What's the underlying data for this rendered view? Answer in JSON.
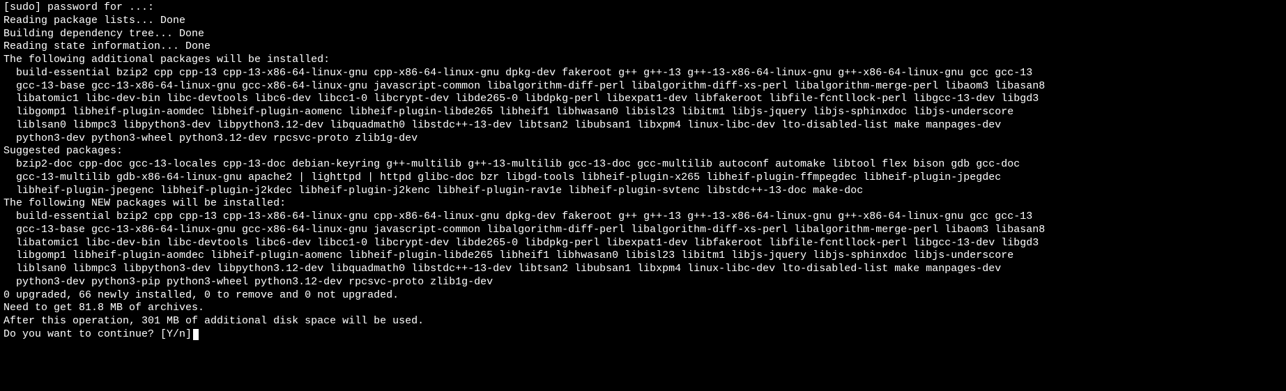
{
  "terminal": {
    "line0": "[sudo] password for ...:",
    "line1": "Reading package lists... Done",
    "line2": "Building dependency tree... Done",
    "line3": "Reading state information... Done",
    "line4": "The following additional packages will be installed:",
    "additional_pkg_1": "build-essential bzip2 cpp cpp-13 cpp-13-x86-64-linux-gnu cpp-x86-64-linux-gnu dpkg-dev fakeroot g++ g++-13 g++-13-x86-64-linux-gnu g++-x86-64-linux-gnu gcc gcc-13",
    "additional_pkg_2": "gcc-13-base gcc-13-x86-64-linux-gnu gcc-x86-64-linux-gnu javascript-common libalgorithm-diff-perl libalgorithm-diff-xs-perl libalgorithm-merge-perl libaom3 libasan8",
    "additional_pkg_3": "libatomic1 libc-dev-bin libc-devtools libc6-dev libcc1-0 libcrypt-dev libde265-0 libdpkg-perl libexpat1-dev libfakeroot libfile-fcntllock-perl libgcc-13-dev libgd3",
    "additional_pkg_4": "libgomp1 libheif-plugin-aomdec libheif-plugin-aomenc libheif-plugin-libde265 libheif1 libhwasan0 libisl23 libitm1 libjs-jquery libjs-sphinxdoc libjs-underscore",
    "additional_pkg_5": "liblsan0 libmpc3 libpython3-dev libpython3.12-dev libquadmath0 libstdc++-13-dev libtsan2 libubsan1 libxpm4 linux-libc-dev lto-disabled-list make manpages-dev",
    "additional_pkg_6": "python3-dev python3-wheel python3.12-dev rpcsvc-proto zlib1g-dev",
    "line_suggested": "Suggested packages:",
    "suggested_pkg_1": "bzip2-doc cpp-doc gcc-13-locales cpp-13-doc debian-keyring g++-multilib g++-13-multilib gcc-13-doc gcc-multilib autoconf automake libtool flex bison gdb gcc-doc",
    "suggested_pkg_2": "gcc-13-multilib gdb-x86-64-linux-gnu apache2 | lighttpd | httpd glibc-doc bzr libgd-tools libheif-plugin-x265 libheif-plugin-ffmpegdec libheif-plugin-jpegdec",
    "suggested_pkg_3": "libheif-plugin-jpegenc libheif-plugin-j2kdec libheif-plugin-j2kenc libheif-plugin-rav1e libheif-plugin-svtenc libstdc++-13-doc make-doc",
    "line_new": "The following NEW packages will be installed:",
    "new_pkg_1": "build-essential bzip2 cpp cpp-13 cpp-13-x86-64-linux-gnu cpp-x86-64-linux-gnu dpkg-dev fakeroot g++ g++-13 g++-13-x86-64-linux-gnu g++-x86-64-linux-gnu gcc gcc-13",
    "new_pkg_2": "gcc-13-base gcc-13-x86-64-linux-gnu gcc-x86-64-linux-gnu javascript-common libalgorithm-diff-perl libalgorithm-diff-xs-perl libalgorithm-merge-perl libaom3 libasan8",
    "new_pkg_3": "libatomic1 libc-dev-bin libc-devtools libc6-dev libcc1-0 libcrypt-dev libde265-0 libdpkg-perl libexpat1-dev libfakeroot libfile-fcntllock-perl libgcc-13-dev libgd3",
    "new_pkg_4": "libgomp1 libheif-plugin-aomdec libheif-plugin-aomenc libheif-plugin-libde265 libheif1 libhwasan0 libisl23 libitm1 libjs-jquery libjs-sphinxdoc libjs-underscore",
    "new_pkg_5": "liblsan0 libmpc3 libpython3-dev libpython3.12-dev libquadmath0 libstdc++-13-dev libtsan2 libubsan1 libxpm4 linux-libc-dev lto-disabled-list make manpages-dev",
    "new_pkg_6": "python3-dev python3-pip python3-wheel python3.12-dev rpcsvc-proto zlib1g-dev",
    "summary_upgraded": "0 upgraded, 66 newly installed, 0 to remove and 0 not upgraded.",
    "summary_download": "Need to get 81.8 MB of archives.",
    "summary_disk": "After this operation, 301 MB of additional disk space will be used.",
    "prompt": "Do you want to continue? [Y/n] "
  }
}
